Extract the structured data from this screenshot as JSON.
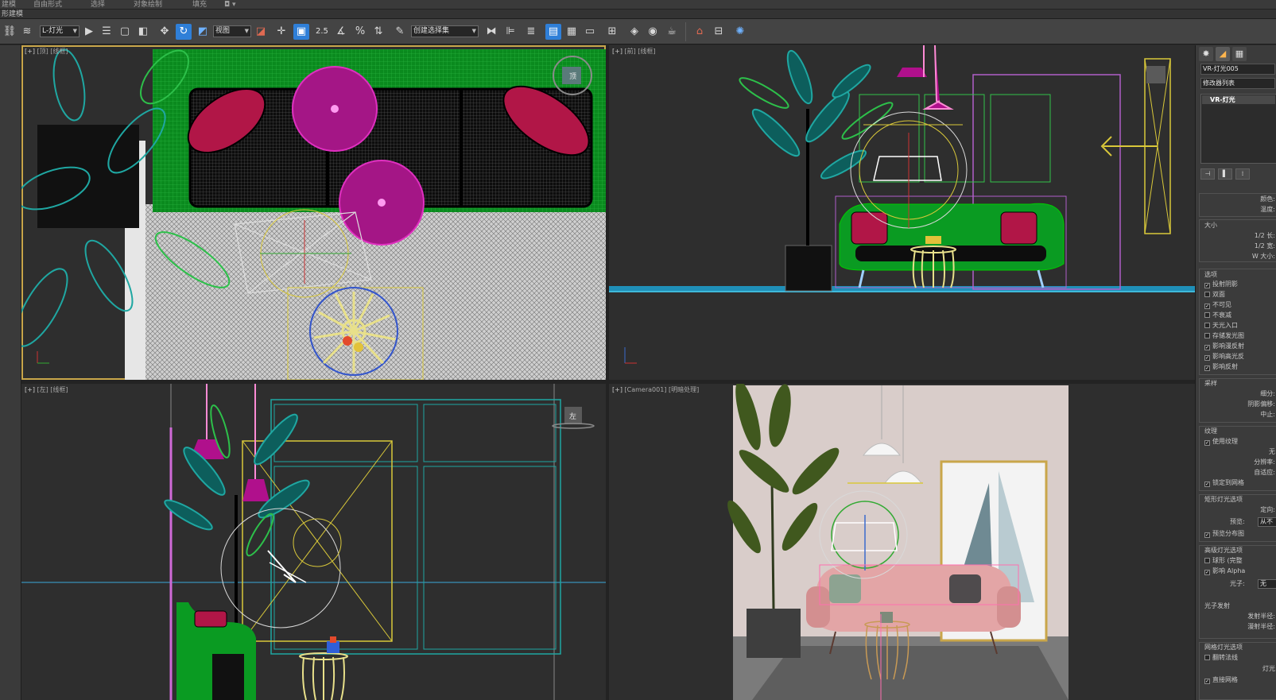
{
  "ribbon": {
    "tabs": [
      "建模",
      "自由形式",
      "选择",
      "对象绘制",
      "填充",
      "◘ ▾"
    ],
    "subtitle": "形建模"
  },
  "toolbar": {
    "selection_filter": "L-灯光",
    "reference_coord": "视图",
    "snap_angle": "2.5",
    "named_selection": "创建选择集"
  },
  "viewports": {
    "top": {
      "label_plus": "[+]",
      "label_view": "[顶]",
      "label_mode": "[线框]",
      "viewcube": "顶"
    },
    "front": {
      "label_plus": "[+]",
      "label_view": "[前]",
      "label_mode": "[线框]"
    },
    "left": {
      "label_plus": "[+]",
      "label_view": "[左]",
      "label_mode": "[线框]",
      "viewcube": "左"
    },
    "camera": {
      "label_plus": "[+]",
      "label_view": "[Camera001]",
      "label_mode": "[明暗处理]"
    }
  },
  "command_panel": {
    "tabs": [
      "create-icon",
      "modify-icon",
      "hierarchy-icon"
    ],
    "object_name": "VR-灯光005",
    "modifier_list": "修改器列表",
    "stack_item": "VR-灯光",
    "stack_buttons": [
      "⊣",
      "▌",
      "⁞"
    ],
    "color_label": "颜色:",
    "temperature_label": "温度:",
    "size_title": "大小",
    "half_length": "1/2 长:",
    "half_width": "1/2 宽:",
    "w_size": "W 大小:",
    "options_title": "选项",
    "options": [
      {
        "label": "投射阴影",
        "checked": true
      },
      {
        "label": "双面",
        "checked": false
      },
      {
        "label": "不可见",
        "checked": true
      },
      {
        "label": "不衰减",
        "checked": false
      },
      {
        "label": "天光入口",
        "checked": false
      },
      {
        "label": "存储发光图",
        "checked": false
      },
      {
        "label": "影响漫反射",
        "checked": true
      },
      {
        "label": "影响高光反",
        "checked": true
      },
      {
        "label": "影响反射",
        "checked": true
      }
    ],
    "sampling_title": "采样",
    "subdivs": "细分:",
    "shadow_bias": "阴影偏移:",
    "cutoff": "中止:",
    "texture_title": "纹理",
    "use_texture": "使用纹理",
    "texture_none": "无",
    "resolution": "分辨率:",
    "adaptive": "自适应:",
    "lock_to": "锁定到网格",
    "rect_options": "矩形灯光选项",
    "directional": "定向:",
    "preview": "预览:",
    "preview_value": "从不",
    "show_distribution": "预览分布图",
    "advanced_options": "高级灯光选项",
    "surface": "球形 (完整",
    "affect_alpha": "影响 Alpha",
    "photon": "光子:",
    "photon_value": "无",
    "photon_emission": "光子发射",
    "emit_radius": "发射半径:",
    "diffuse_radius": "漫射半径:",
    "mesh_options": "网格灯光选项",
    "flip_normals": "翻转法线",
    "light_options": "灯光",
    "mesh_setting": "直接网格"
  },
  "colors": {
    "wireframe_green": "#0a9b22",
    "wireframe_cyan": "#1fa7a2",
    "wireframe_magenta": "#b0108c",
    "pillow_red": "#b11647",
    "light_yellow": "#d9c83a",
    "sofa_pink": "#e3a5a6",
    "wall_pink": "#d9cdca",
    "active_blue": "#2f7fd8"
  }
}
